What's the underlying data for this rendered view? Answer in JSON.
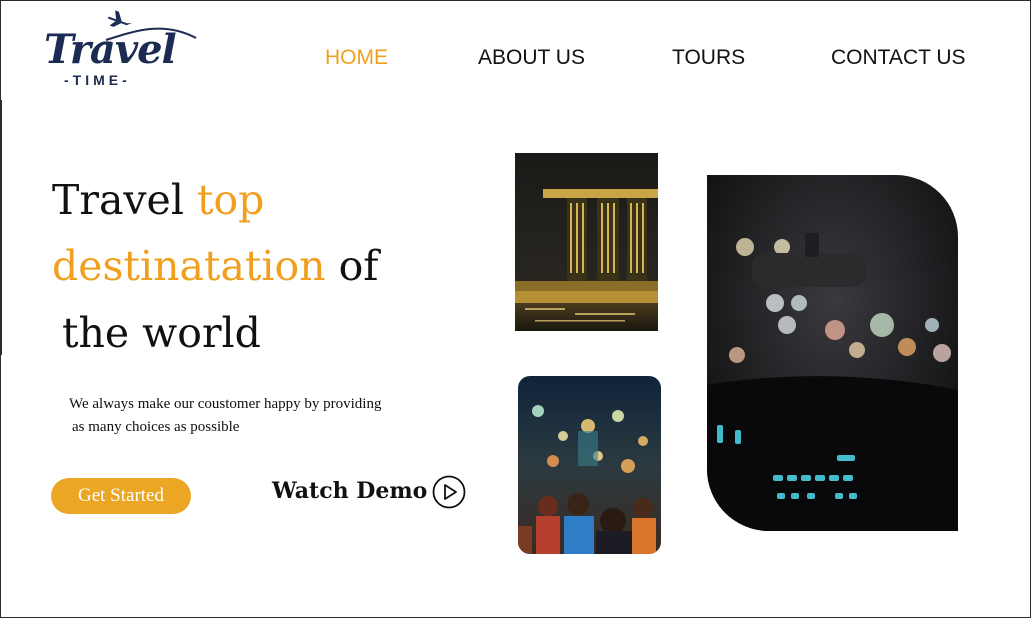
{
  "logo": {
    "word": "Travel",
    "sub": "-TIME-"
  },
  "nav": {
    "home": "HOME",
    "about": "ABOUT US",
    "tours": "TOURS",
    "contact": "CONTACT US"
  },
  "hero": {
    "line1_a": "Travel ",
    "line1_b": "top",
    "line2_a": "destinatation",
    "line2_b": " of",
    "line3": "the world",
    "subtitle_1": "We always make our coustomer happy by providing",
    "subtitle_2": "as many choices as possible"
  },
  "actions": {
    "get_started": "Get Started",
    "watch_demo": "Watch Demo"
  },
  "colors": {
    "accent": "#f0a01e",
    "button": "#eba623",
    "logo": "#1c2b52"
  }
}
